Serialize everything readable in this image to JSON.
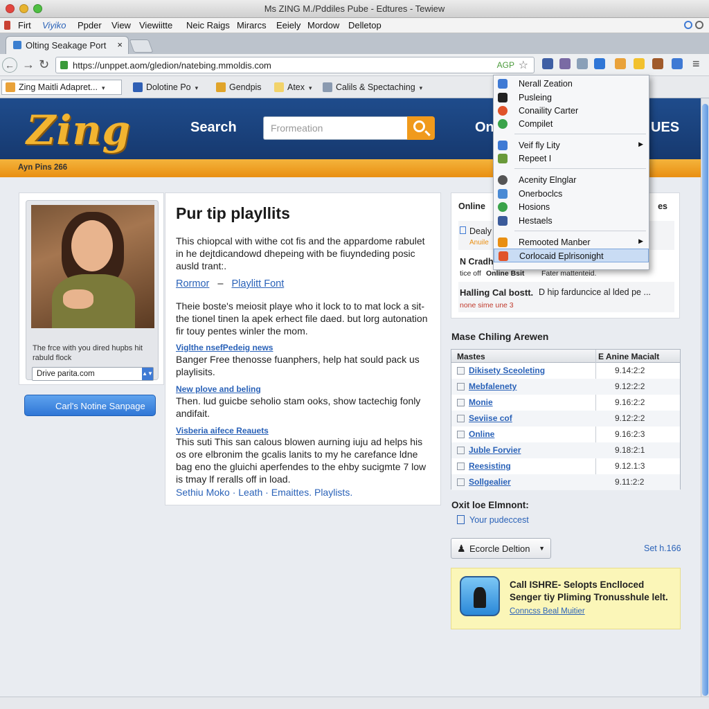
{
  "window": {
    "title": "Ms ZING M./Pddiles Pube - Edtures - Tewiew"
  },
  "menubar": {
    "items": [
      "Firt",
      "Viyiko",
      "Ppder",
      "View",
      "Viewiitte",
      "Neic Raigs",
      "Mirarcs",
      "Eeiely",
      "Mordow",
      "Delletop"
    ]
  },
  "tab": {
    "label": "Olting Seakage Port",
    "close": "×"
  },
  "toolbar": {
    "url": "https://unppet.aom/gledion/natebing.mmoldis.com",
    "addon": "AGP"
  },
  "bookmarks": [
    {
      "label": "Zing Maitli Adapret...",
      "dropdown": "▾"
    },
    {
      "label": "Dolotine Po",
      "dropdown": "▾"
    },
    {
      "label": "Gendpis",
      "dropdown": ""
    },
    {
      "label": "Atex",
      "dropdown": "▾"
    },
    {
      "label": "Calils & Spectaching",
      "dropdown": "▾"
    }
  ],
  "site": {
    "logo": "Zing",
    "search_label": "Search",
    "search_placeholder": "Frormeation",
    "header_right_1": "On",
    "header_right_2": "UES",
    "ribbon": "Ayn Pins 266"
  },
  "left": {
    "caption": "The frce with you dired hupbs hit rabuld flock",
    "select_value": "Drive parita.com",
    "button_icon": "",
    "button_label": "Carl's Notine Sanpage"
  },
  "article": {
    "title": "Pur tip playllits",
    "intro": "This chiopcal with withe cot fis and the appardome rabulet in he dejtdicandowd dhepeing with be fiuyndeding posic ausld trant:.",
    "link1": "Rormor",
    "link_sep": "–",
    "link2": "Playlitt Font",
    "para2": "Theie boste's meiosit playe who it lock to to mat lock a sit-the tionel tinen la apek erhect file daed. but lorg autonation fir touy pentes winler the mom.",
    "sub1": "Viglthe nsefPedeig news",
    "para3": "Banger Free thenosse fuanphers, help hat sould pack us playlisits.",
    "sub2": "New plove and beling",
    "para4": "Then. lud guicbe seholio stam ooks, show tactechig fonly andifait.",
    "sub3": "Visberia aifece Reauets",
    "para5": "This suti This san calous blowen aurning iuju ad helps his os ore elbronim the gcalis lanits to my he carefance ldne bag eno the gluichi aperfendes to the ehby sucigmte 7 low is tmay lf reralls off in load.",
    "footer_links": "Sethiu Moko · Leath · Emaittes. Playlists."
  },
  "right": {
    "rows": [
      {
        "title": "Online",
        "tail": "es"
      },
      {
        "title": "Dealy",
        "tail": ""
      },
      {
        "title": "Anuile",
        "tail": ""
      },
      {
        "title": "N Cradhu",
        "tail": ""
      },
      {
        "title": "Online Bsit",
        "sub": "tice off",
        "tail": "Fater mattenteid."
      },
      {
        "title": "Halling Cal bostt.",
        "tail": "D hip farduncice al lded pe ..."
      },
      {
        "title": "none sime une 3",
        "tail": ""
      }
    ]
  },
  "table": {
    "heading": "Mase Chiling Arewen",
    "col1": "Mastes",
    "col2": "E Anine Macialt",
    "rows": [
      {
        "name": "Dikisety Sceoleting",
        "value": "9.14:2:2"
      },
      {
        "name": "Mebfalenety",
        "value": "9.12:2:2"
      },
      {
        "name": "Monie",
        "value": "9.16:2:2"
      },
      {
        "name": "Seviise cof",
        "value": "9.12:2:2"
      },
      {
        "name": "Online",
        "value": "9.16:2:3"
      },
      {
        "name": "Juble Forvier",
        "value": "9.18:2:1"
      },
      {
        "name": "Reesisting",
        "value": "9.12.1:3"
      },
      {
        "name": "Sollgealier",
        "value": "9.11:2:2"
      }
    ]
  },
  "below": {
    "oxit": "Oxit loe Elmnont:",
    "yourpc": "Your pudeccest",
    "select_label": "Ecorcle Deltion",
    "seth": "Set h.166",
    "promo_title": "Call ISHRE- Selopts Enclloced Senger tiy Pliming Tronusshule lelt.",
    "promo_link": "Conncss Beal Muitier"
  },
  "dropdown": {
    "items": [
      {
        "label": "Nerall Zeation",
        "color": "#3f7ad4"
      },
      {
        "label": "Pusleing",
        "color": "#222222"
      },
      {
        "label": "Conaility Carter",
        "color": "#e0532a"
      },
      {
        "label": "Compilet",
        "color": "#3aa34a"
      },
      {
        "label": "Veif fly Lity",
        "color": "#3f7ad4",
        "sub": "▶"
      },
      {
        "label": "Repeet I",
        "color": "#6a9a3a"
      },
      {
        "label": "Acenity Elnglar",
        "color": "#555555"
      },
      {
        "label": "Onerboclcs",
        "color": "#4a8ad4"
      },
      {
        "label": "Hosions",
        "color": "#3aa34a"
      },
      {
        "label": "Hestaels",
        "color": "#3a5a9a"
      },
      {
        "label": "Remooted Manber",
        "color": "#e98f12",
        "sub": "▶"
      },
      {
        "label": "Corlocaid Eplrisonight",
        "color": "#e0532a"
      }
    ]
  },
  "colors": {
    "brand_blue": "#1f4c8c",
    "accent_orange": "#f09a1c",
    "link_blue": "#2a62b8"
  }
}
